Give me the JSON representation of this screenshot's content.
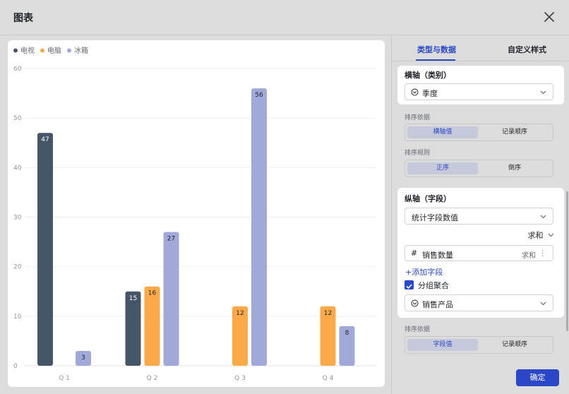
{
  "dialog": {
    "title": "图表"
  },
  "tabs": [
    {
      "label": "类型与数据"
    },
    {
      "label": "自定义样式"
    }
  ],
  "x_axis": {
    "title": "横轴（类别）",
    "field": "季度",
    "sort_by_label": "排序依据",
    "sort_by_options": [
      "横轴值",
      "记录顺序"
    ],
    "sort_order_label": "排序规则",
    "sort_order_options": [
      "正序",
      "倒序"
    ]
  },
  "y_axis": {
    "title": "纵轴（字段）",
    "mode": "统计字段数值",
    "aggregate": "求和",
    "field_name": "销售数量",
    "field_agg": "求和",
    "add_field": "+添加字段",
    "group_label": "分组聚合",
    "group_field": "销售产品",
    "sort_by_label": "排序依据",
    "sort_by_options": [
      "字段值",
      "记录顺序"
    ]
  },
  "confirm_label": "确定",
  "colors": {
    "accent": "#2a47c7",
    "tv": "#475569",
    "pc": "#fca94a",
    "fridge": "#a1a9d8"
  },
  "chart_data": {
    "type": "bar",
    "categories": [
      "Q 1",
      "Q 2",
      "Q 3",
      "Q 4"
    ],
    "series": [
      {
        "name": "电视",
        "color": "#475569",
        "values": [
          47,
          15,
          null,
          null
        ]
      },
      {
        "name": "电脑",
        "color": "#fca94a",
        "values": [
          null,
          16,
          12,
          12
        ]
      },
      {
        "name": "冰箱",
        "color": "#a1a9d8",
        "values": [
          3,
          27,
          56,
          8
        ]
      }
    ],
    "yticks": [
      0,
      10,
      20,
      30,
      40,
      50,
      60
    ],
    "ylim": [
      0,
      60
    ],
    "grid": true,
    "legend_position": "top-left",
    "data_labels": true
  }
}
